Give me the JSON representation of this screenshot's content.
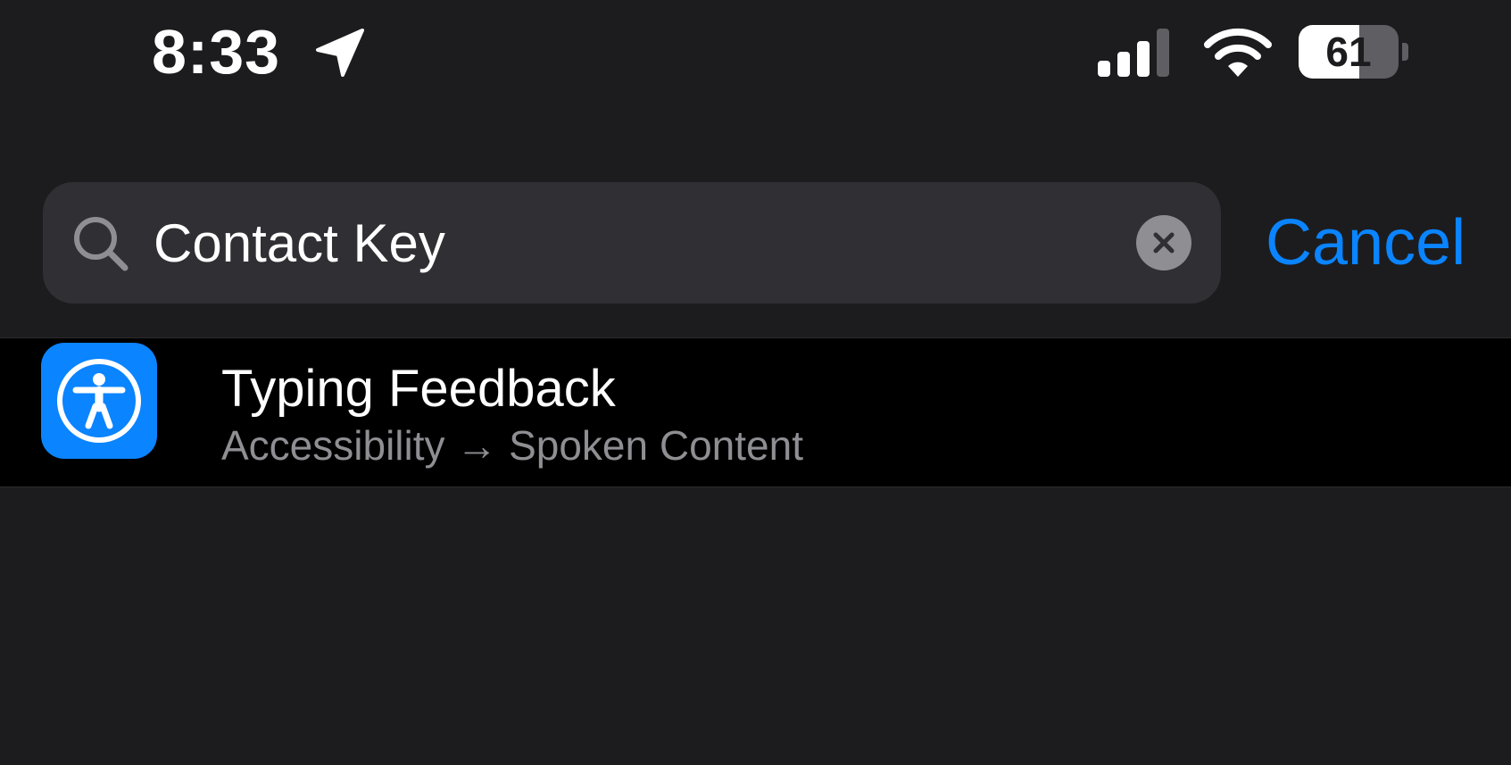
{
  "status_bar": {
    "time": "8:33",
    "battery_percent": "61",
    "battery_level": 0.61,
    "icons": [
      "location-arrow-icon",
      "cellular-signal-icon",
      "wifi-icon",
      "battery-icon"
    ]
  },
  "search": {
    "value": "Contact Key",
    "icon": "search-icon",
    "clear_icon": "clear-icon",
    "cancel_label": "Cancel"
  },
  "results": [
    {
      "title": "Typing Feedback",
      "path": "Accessibility → Spoken Content",
      "icon": "accessibility-icon"
    }
  ],
  "colors": {
    "background": "#1c1c1e",
    "search_field": "#2f2f34",
    "accent": "#0a84ff",
    "secondary_text": "#8e8e93",
    "row_background": "#000000"
  }
}
